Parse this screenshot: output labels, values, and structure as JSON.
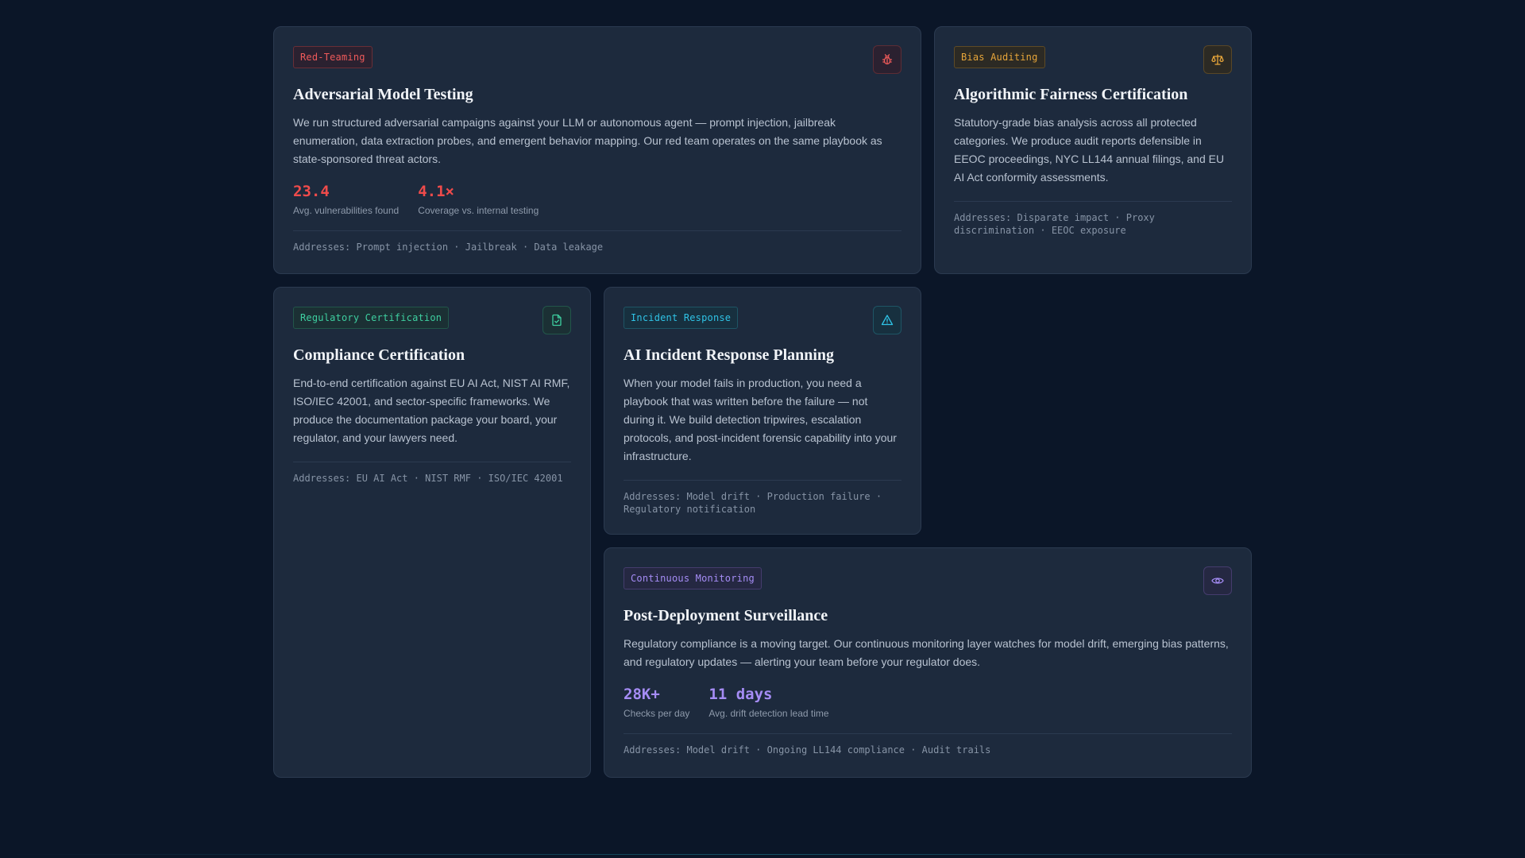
{
  "colors": {
    "background": "#0b1628",
    "card": "#1d2a3d",
    "red": "#ef4b4b",
    "amber": "#e8a63a",
    "green": "#3ecfa0",
    "cyan": "#2fc3e6",
    "violet": "#a58cf5"
  },
  "cards": [
    {
      "tag": "Red-Teaming",
      "icon": "bug-icon",
      "title": "Adversarial Model Testing",
      "description": "We run structured adversarial campaigns against your LLM or autonomous agent — prompt injection, jailbreak enumeration, data extraction probes, and emergent behavior mapping. Our red team operates on the same playbook as state-sponsored threat actors.",
      "stats": [
        {
          "value": "23.4",
          "label": "Avg. vulnerabilities found"
        },
        {
          "value": "4.1×",
          "label": "Coverage vs. internal testing"
        }
      ],
      "addresses": "Addresses: Prompt injection · Jailbreak · Data leakage"
    },
    {
      "tag": "Bias Auditing",
      "icon": "scales-icon",
      "title": "Algorithmic Fairness Certification",
      "description": "Statutory-grade bias analysis across all protected categories. We produce audit reports defensible in EEOC proceedings, NYC LL144 annual filings, and EU AI Act conformity assessments.",
      "addresses": "Addresses: Disparate impact · Proxy discrimination · EEOC exposure"
    },
    {
      "tag": "Regulatory Certification",
      "icon": "document-check-icon",
      "title": "Compliance Certification",
      "description": "End-to-end certification against EU AI Act, NIST AI RMF, ISO/IEC 42001, and sector-specific frameworks. We produce the documentation package your board, your regulator, and your lawyers need.",
      "addresses": "Addresses: EU AI Act · NIST RMF · ISO/IEC 42001"
    },
    {
      "tag": "Incident Response",
      "icon": "warning-triangle-icon",
      "title": "AI Incident Response Planning",
      "description": "When your model fails in production, you need a playbook that was written before the failure — not during it. We build detection tripwires, escalation protocols, and post-incident forensic capability into your infrastructure.",
      "addresses": "Addresses: Model drift · Production failure · Regulatory notification"
    },
    {
      "tag": "Continuous Monitoring",
      "icon": "eye-icon",
      "title": "Post-Deployment Surveillance",
      "description": "Regulatory compliance is a moving target. Our continuous monitoring layer watches for model drift, emerging bias patterns, and regulatory updates — alerting your team before your regulator does.",
      "stats": [
        {
          "value": "28K+",
          "label": "Checks per day"
        },
        {
          "value": "11 days",
          "label": "Avg. drift detection lead time"
        }
      ],
      "addresses": "Addresses: Model drift · Ongoing LL144 compliance · Audit trails"
    }
  ]
}
